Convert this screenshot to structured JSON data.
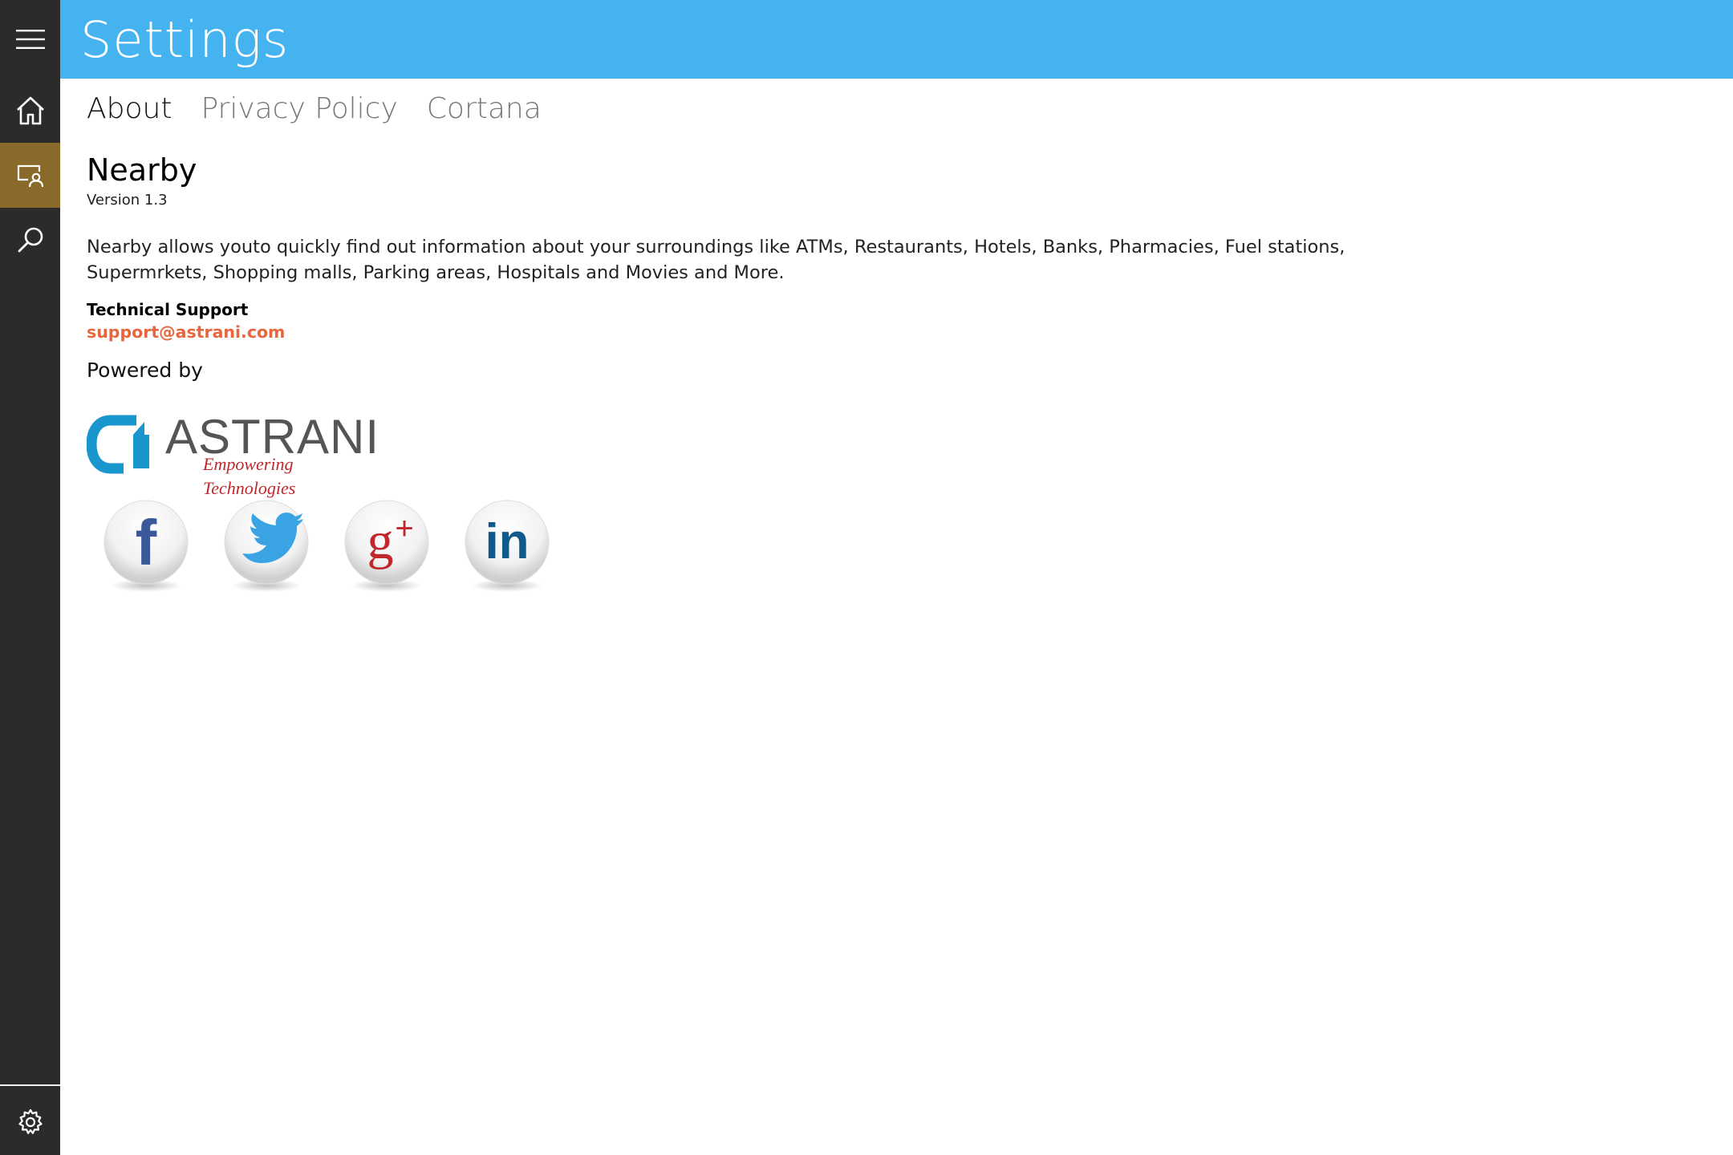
{
  "window": {
    "title": "Settings"
  },
  "sidebar": {
    "items": [
      {
        "name": "menu",
        "icon": "hamburger-icon"
      },
      {
        "name": "home",
        "icon": "home-icon"
      },
      {
        "name": "nearby",
        "icon": "nearby-icon",
        "selected": true
      },
      {
        "name": "search",
        "icon": "search-icon"
      },
      {
        "name": "settings",
        "icon": "gear-icon"
      }
    ],
    "colors": {
      "background": "#2b2b2b",
      "selected": "#8a6a2a"
    }
  },
  "header": {
    "color": "#45b3f0"
  },
  "tabs": [
    {
      "label": "About",
      "active": true
    },
    {
      "label": "Privacy Policy",
      "active": false
    },
    {
      "label": "Cortana",
      "active": false
    }
  ],
  "about": {
    "app_name": "Nearby",
    "version": "Version 1.3",
    "description": "Nearby allows youto quickly find out information about your surroundings like ATMs, Restaurants, Hotels, Banks, Pharmacies, Fuel stations, Supermrkets, Shopping malls, Parking areas, Hospitals and Movies and More.",
    "support_label": "Technical Support",
    "support_email": "support@astrani.com",
    "powered_by": "Powered by",
    "logo": {
      "name": "ASTRANI",
      "tagline": "Empowering Technologies"
    },
    "social": [
      {
        "name": "facebook",
        "icon": "facebook-icon",
        "glyph": "f",
        "color": "#3b5998"
      },
      {
        "name": "twitter",
        "icon": "twitter-icon",
        "color": "#3aa3e3"
      },
      {
        "name": "google-plus",
        "icon": "google-plus-icon",
        "glyph": "g+",
        "color": "#c0282d"
      },
      {
        "name": "linkedin",
        "icon": "linkedin-icon",
        "glyph": "in",
        "color": "#0e5a8a"
      }
    ]
  }
}
